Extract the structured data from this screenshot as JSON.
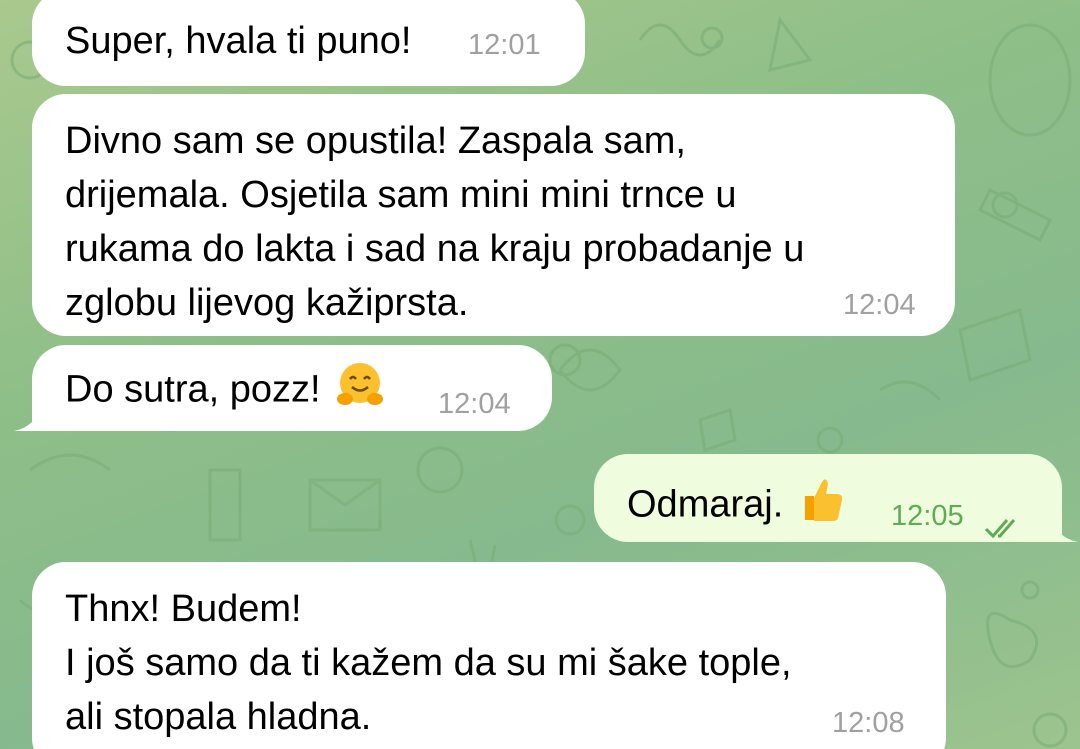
{
  "messages": [
    {
      "text": "Super, hvala ti puno!",
      "time": "12:01",
      "direction": "incoming"
    },
    {
      "text": "Divno sam se opustila! Zaspala sam,\ndrijemala. Osjetila sam mini mini trnce u\nrukama do lakta i sad na kraju probadanje u\nzglobu lijevog kažiprsta.",
      "time": "12:04",
      "direction": "incoming"
    },
    {
      "text": "Do sutra, pozz!",
      "emoji": "hugging-face",
      "time": "12:04",
      "direction": "incoming"
    },
    {
      "text": "Odmaraj.",
      "emoji": "thumbs-up",
      "time": "12:05",
      "direction": "outgoing",
      "status": "read"
    },
    {
      "text": "Thnx! Budem!\nI još samo da ti kažem da su mi šake tople,\nali stopala hladna.",
      "time": "12:08",
      "direction": "incoming"
    }
  ],
  "colors": {
    "incoming_bubble": "#ffffff",
    "outgoing_bubble": "#effdde",
    "timestamp": "#a0a0a0",
    "outgoing_timestamp": "#5fab52",
    "wallpaper": "#8fbf88"
  }
}
